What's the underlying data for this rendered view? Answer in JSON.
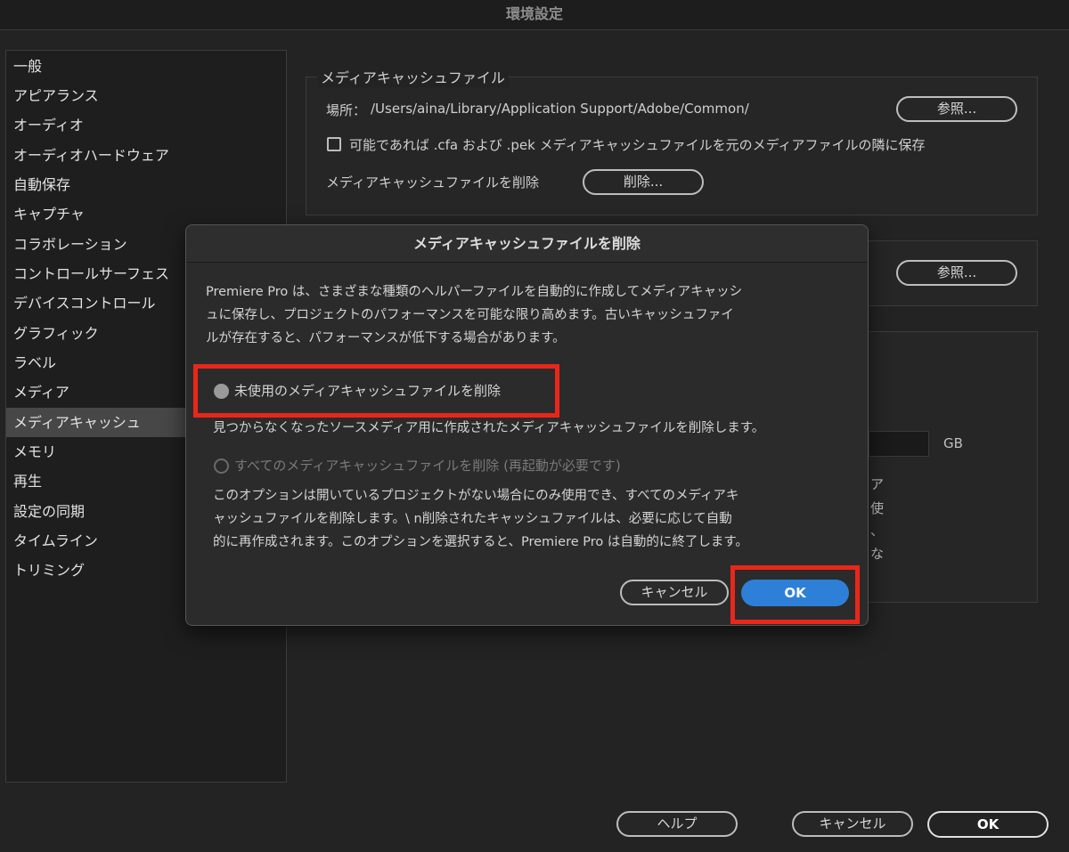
{
  "window": {
    "title": "環境設定"
  },
  "sidebar": {
    "items": [
      {
        "label": "一般"
      },
      {
        "label": "アピアランス"
      },
      {
        "label": "オーディオ"
      },
      {
        "label": "オーディオハードウェア"
      },
      {
        "label": "自動保存"
      },
      {
        "label": "キャプチャ"
      },
      {
        "label": "コラボレーション"
      },
      {
        "label": "コントロールサーフェス"
      },
      {
        "label": "デバイスコントロール"
      },
      {
        "label": "グラフィック"
      },
      {
        "label": "ラベル"
      },
      {
        "label": "メディア"
      },
      {
        "label": "メディアキャッシュ",
        "selected": true
      },
      {
        "label": "メモリ"
      },
      {
        "label": "再生"
      },
      {
        "label": "設定の同期"
      },
      {
        "label": "タイムライン"
      },
      {
        "label": "トリミング"
      }
    ]
  },
  "media_cache_files": {
    "group_title": "メディアキャッシュファイル",
    "location_label": "場所：",
    "location_path": "/Users/aina/Library/Application Support/Adobe/Common/",
    "browse_label": "参照...",
    "checkbox_label": "可能であれば .cfa および .pek メディアキャッシュファイルを元のメディアファイルの隣に保存",
    "checkbox_checked": false,
    "delete_label": "メディアキャッシュファイルを削除",
    "delete_button": "削除..."
  },
  "media_cache_db": {
    "browse_label": "参照..."
  },
  "background_fragments": {
    "gb_unit": "GB",
    "frag1": "ア",
    "frag2": "使",
    "frag3": "、",
    "frag4": "な"
  },
  "dialog": {
    "title": "メディアキャッシュファイルを削除",
    "description_lines": [
      "Premiere Pro は、さまざまな種類のヘルパーファイルを自動的に作成してメディアキャッシ",
      "ュに保存し、プロジェクトのパフォーマンスを可能な限り高めます。古いキャッシュファイ",
      "ルが存在すると、パフォーマンスが低下する場合があります。"
    ],
    "option_unused_label": "未使用のメディアキャッシュファイルを削除",
    "option_unused_desc": "見つからなくなったソースメディア用に作成されたメディアキャッシュファイルを削除します。",
    "option_all_label": "すべてのメディアキャッシュファイルを削除 (再起動が必要です)",
    "option_all_desc_lines": [
      "このオプションは開いているプロジェクトがない場合にのみ使用でき、すべてのメディアキ",
      "ャッシュファイルを削除します。\\ n削除されたキャッシュファイルは、必要に応じて自動",
      "的に再作成されます。このオプションを選択すると、Premiere Pro は自動的に終了します。"
    ],
    "selected_option": "unused",
    "cancel_label": "キャンセル",
    "ok_label": "OK"
  },
  "footer": {
    "help_label": "ヘルプ",
    "cancel_label": "キャンセル",
    "ok_label": "OK"
  },
  "colors": {
    "background": "#232323",
    "accent_blue": "#2d7fd8",
    "highlight_red": "#e8271a"
  }
}
